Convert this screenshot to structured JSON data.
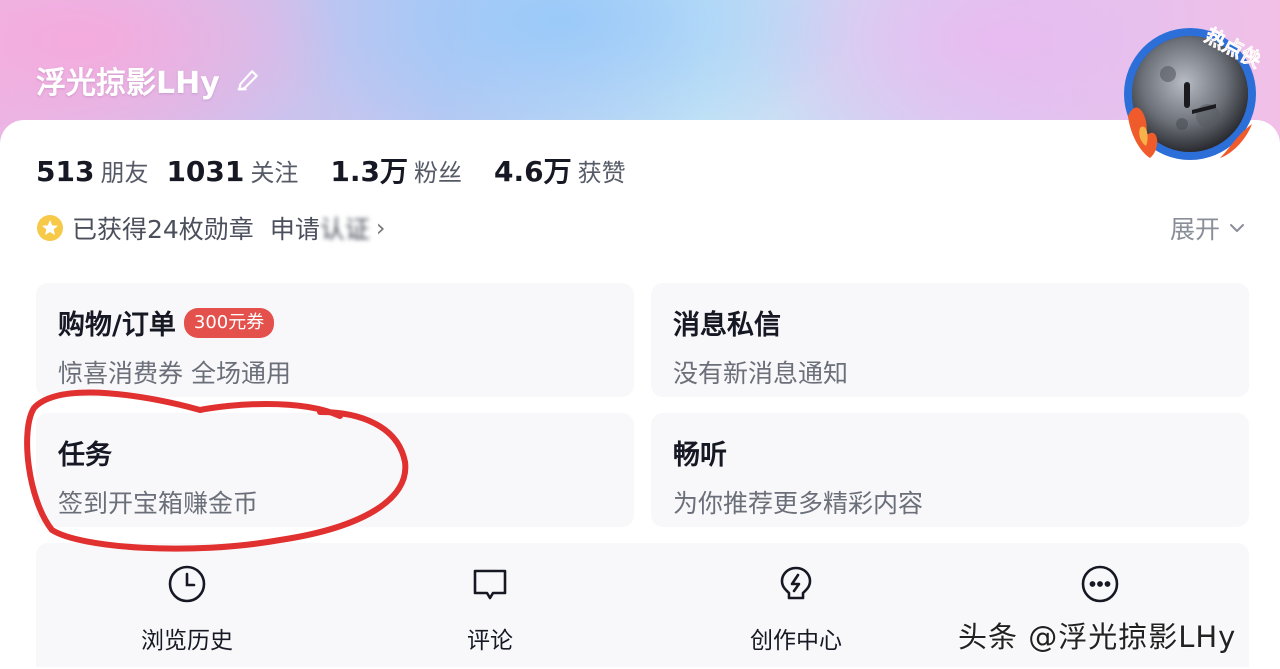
{
  "profile": {
    "username": "浮光掠影LHy",
    "avatar_tag": "热点侠"
  },
  "stats": [
    {
      "value": "513",
      "label": "朋友"
    },
    {
      "value": "1031",
      "label": "关注"
    },
    {
      "value": "1.3万",
      "label": "粉丝"
    },
    {
      "value": "4.6万",
      "label": "获赞"
    }
  ],
  "medals": {
    "text": "已获得24枚勋章",
    "apply_prefix": "申请",
    "apply_blurred": "认证",
    "expand": "展开"
  },
  "tiles": {
    "shop": {
      "title": "购物/订单",
      "badge": "300元券",
      "subtitle": "惊喜消费券 全场通用"
    },
    "messages": {
      "title": "消息私信",
      "subtitle": "没有新消息通知"
    },
    "tasks": {
      "title": "任务",
      "subtitle": "签到开宝箱赚金币"
    },
    "listen": {
      "title": "畅听",
      "subtitle": "为你推荐更多精彩内容"
    }
  },
  "quick_actions": [
    {
      "label": "浏览历史",
      "icon": "clock-icon"
    },
    {
      "label": "评论",
      "icon": "comment-icon"
    },
    {
      "label": "创作中心",
      "icon": "lightbulb-icon"
    },
    {
      "label": "更多",
      "icon": "more-icon"
    }
  ],
  "watermark": "头条 @浮光掠影LHy",
  "colors": {
    "badge_red": "#e4504b",
    "annotation_red": "#e0302f",
    "tile_bg": "#f8f8fa"
  }
}
